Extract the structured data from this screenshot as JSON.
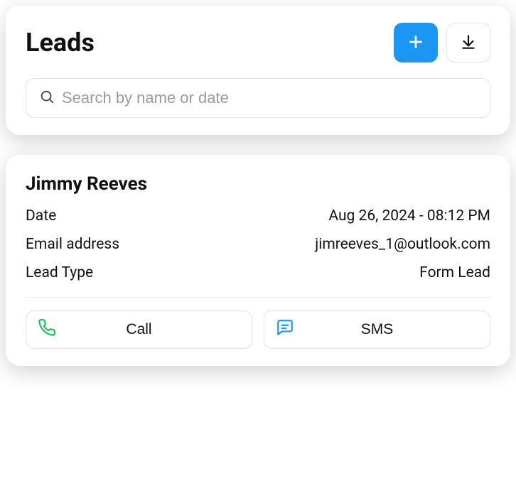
{
  "header": {
    "title": "Leads"
  },
  "search": {
    "placeholder": "Search by name or date",
    "value": ""
  },
  "lead": {
    "name": "Jimmy Reeves",
    "fields": {
      "date_label": "Date",
      "date_value": "Aug 26, 2024 - 08:12 PM",
      "email_label": "Email address",
      "email_value": "jimreeves_1@outlook.com",
      "type_label": "Lead Type",
      "type_value": "Form Lead"
    },
    "actions": {
      "call_label": "Call",
      "sms_label": "SMS"
    }
  },
  "icons": {
    "plus": "plus-icon",
    "download": "download-icon",
    "search": "search-icon",
    "phone": "phone-icon",
    "sms": "message-icon"
  },
  "colors": {
    "primary": "#1b97f3",
    "phone": "#1fbf5c",
    "sms": "#1b97f3"
  }
}
